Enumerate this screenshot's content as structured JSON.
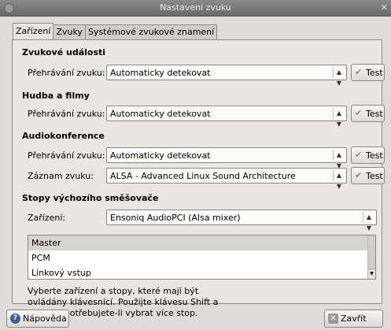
{
  "window": {
    "title": "Nastavení zvuku",
    "close": "✕"
  },
  "tabs": [
    "Zařízení",
    "Zvuky",
    "Systémové zvukové znamení"
  ],
  "events": {
    "heading": "Zvukové události",
    "playback_label": "Přehrávání zvuku:",
    "playback_value": "Automaticky detekovat",
    "test": "Test"
  },
  "music": {
    "heading": "Hudba a filmy",
    "playback_label": "Přehrávání zvuku:",
    "playback_value": "Automaticky detekovat",
    "test": "Test"
  },
  "conference": {
    "heading": "Audiokonference",
    "playback_label": "Přehrávání zvuku:",
    "playback_value": "Automaticky detekovat",
    "record_label": "Záznam zvuku:",
    "record_value": "ALSA - Advanced Linux Sound Architecture",
    "test": "Test"
  },
  "mixer": {
    "heading": "Stopy výchozího směšovače",
    "device_label": "Zařízení:",
    "device_value": "Ensoniq AudioPCI (Alsa mixer)",
    "tracks": [
      "Master",
      "PCM",
      "Linkový vstup"
    ],
    "help": "Vyberte zařízení a stopy, které mají být ovládány klávesnicí. Použijte klávesu Shift a Control, potřebujete-li vybrat více stop."
  },
  "footer": {
    "help": "Nápověda",
    "close": "Zavřít"
  },
  "colors": {
    "titlebar": "#6a6a6a",
    "selection": "#d6d4cf",
    "window": "#dedcd7"
  },
  "icons": {
    "combo": "chevron-updown-icon",
    "test": "check-icon",
    "help": "help-icon",
    "close": "close-icon"
  }
}
